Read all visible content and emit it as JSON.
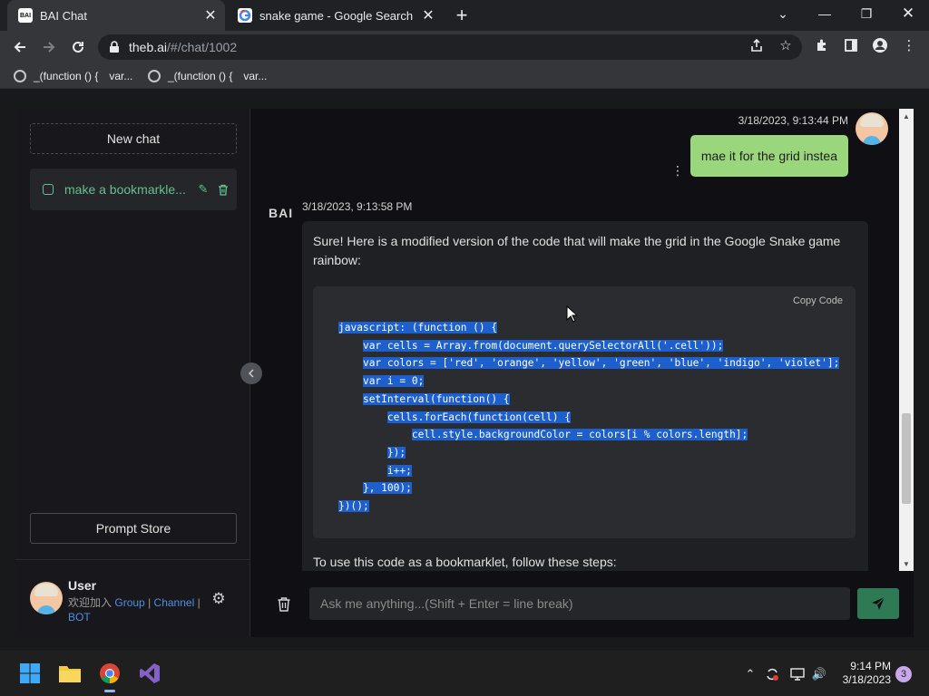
{
  "browser": {
    "tabs": [
      {
        "title": "BAI Chat",
        "favicon": "bai-logo-icon",
        "active": true
      },
      {
        "title": "snake game - Google Search",
        "favicon": "google-icon",
        "active": false
      }
    ],
    "url_host": "theb.ai",
    "url_path": "/#/chat/1002",
    "bookmarks": [
      {
        "label": "_(function () {",
        "extra": "var..."
      },
      {
        "label": "_(function () {",
        "extra": "var..."
      }
    ]
  },
  "sidebar": {
    "new_chat_label": "New chat",
    "chats": [
      {
        "label": "make a bookmarkle..."
      }
    ],
    "prompt_store_label": "Prompt Store",
    "user": {
      "name": "User",
      "join_text": "欢迎加入",
      "links": [
        "Group",
        "Channel",
        "BOT"
      ],
      "separator": "|"
    }
  },
  "conversation": {
    "user_message": {
      "timestamp": "3/18/2023, 9:13:44 PM",
      "text": "mae it for the grid instea"
    },
    "bot_message": {
      "logo": "BAI",
      "timestamp": "3/18/2023, 9:13:58 PM",
      "intro": "Sure! Here is a modified version of the code that will make the grid in the Google Snake game rainbow:",
      "code_actions": "Copy  Code",
      "code_lines": [
        "javascript: (function () {",
        "    var cells = Array.from(document.querySelectorAll('.cell'));",
        "    var colors = ['red', 'orange', 'yellow', 'green', 'blue', 'indigo', 'violet'];",
        "    var i = 0;",
        "    setInterval(function() {",
        "        cells.forEach(function(cell) {",
        "            cell.style.backgroundColor = colors[i % colors.length];",
        "        });",
        "        i++;",
        "    }, 100);",
        "})();"
      ],
      "outro": "To use this code as a bookmarklet, follow these steps:"
    }
  },
  "input": {
    "placeholder": "Ask me anything...(Shift + Enter = line break)"
  },
  "taskbar": {
    "time": "9:14 PM",
    "date": "3/18/2023",
    "notification_count": "3"
  },
  "colors": {
    "accent_green": "#63c18d",
    "user_bubble": "#9ad77c",
    "send_button": "#2d7a55",
    "selection": "#1d5fcc"
  }
}
